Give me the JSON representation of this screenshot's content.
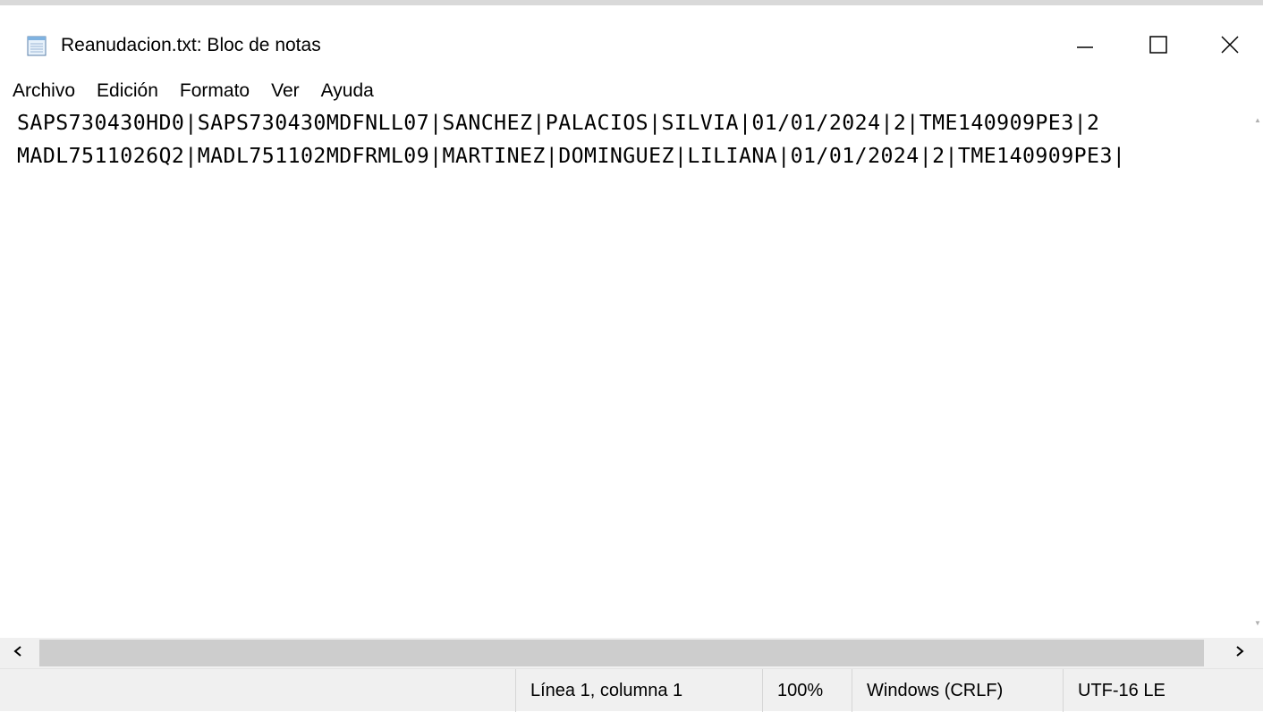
{
  "window": {
    "title": "Reanudacion.txt: Bloc de notas",
    "app_icon": "notepad-icon"
  },
  "controls": {
    "minimize_icon": "minimize-icon",
    "maximize_icon": "maximize-icon",
    "close_icon": "close-icon"
  },
  "menu": {
    "items": [
      {
        "label": "Archivo"
      },
      {
        "label": "Edición"
      },
      {
        "label": "Formato"
      },
      {
        "label": "Ver"
      },
      {
        "label": "Ayuda"
      }
    ]
  },
  "editor": {
    "lines": [
      "SAPS730430HD0|SAPS730430MDFNLL07|SANCHEZ|PALACIOS|SILVIA|01/01/2024|2|TME140909PE3|2",
      "MADL7511026Q2|MADL751102MDFRML09|MARTINEZ|DOMINGUEZ|LILIANA|01/01/2024|2|TME140909PE3|"
    ]
  },
  "scrollbar": {
    "left_icon": "chevron-left-icon",
    "right_icon": "chevron-right-icon"
  },
  "status": {
    "position": "Línea 1, columna 1",
    "zoom": "100%",
    "line_ending": "Windows (CRLF)",
    "encoding": "UTF-16 LE"
  }
}
